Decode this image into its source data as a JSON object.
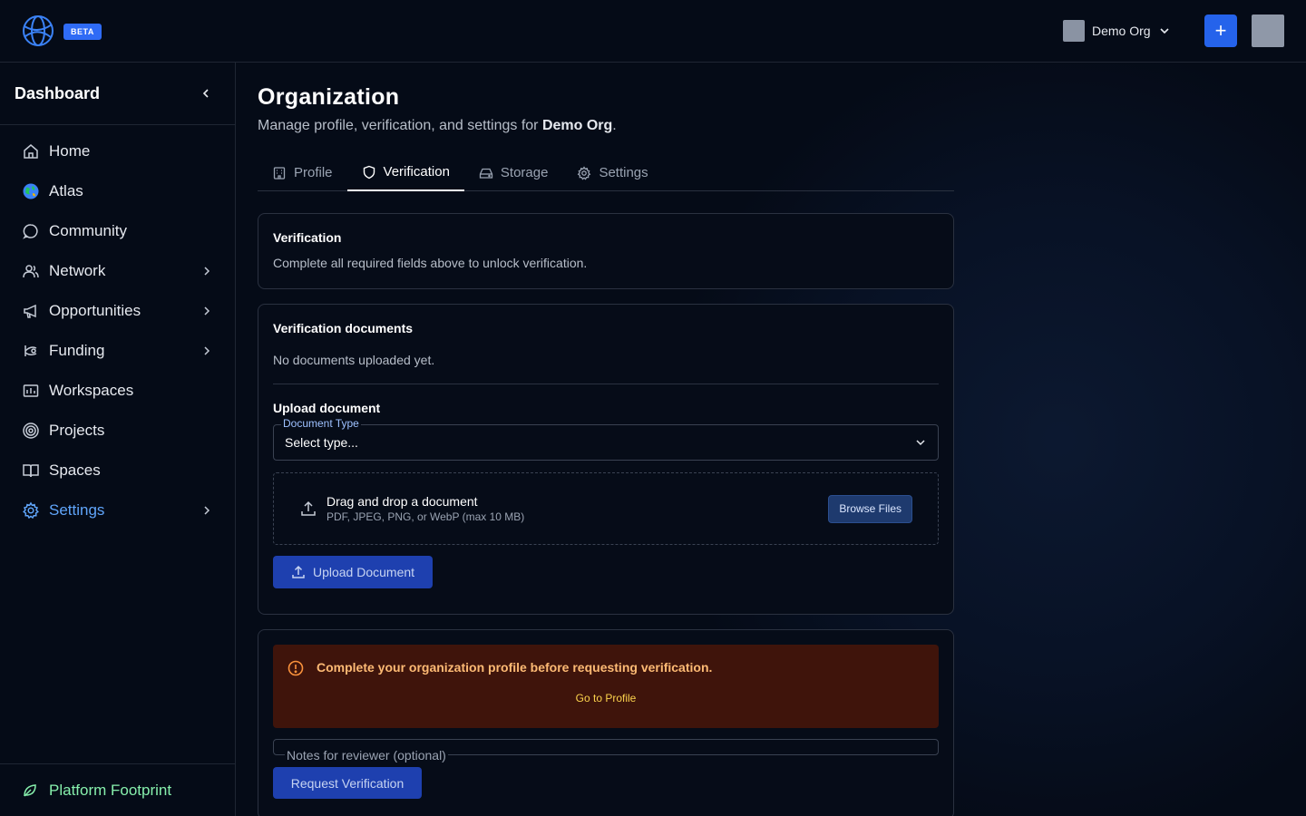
{
  "topbar": {
    "badge": "BETA",
    "org_name": "Demo Org",
    "plus_label": "+"
  },
  "sidebar": {
    "title": "Dashboard",
    "items": [
      {
        "label": "Home",
        "icon": "home-icon"
      },
      {
        "label": "Atlas",
        "icon": "globe-icon"
      },
      {
        "label": "Community",
        "icon": "chat-icon"
      },
      {
        "label": "Network",
        "icon": "users-icon"
      },
      {
        "label": "Opportunities",
        "icon": "megaphone-icon"
      },
      {
        "label": "Funding",
        "icon": "funding-icon"
      },
      {
        "label": "Workspaces",
        "icon": "workspace-icon"
      },
      {
        "label": "Projects",
        "icon": "target-icon"
      },
      {
        "label": "Spaces",
        "icon": "book-icon"
      },
      {
        "label": "Settings",
        "icon": "gear-icon"
      }
    ],
    "footer": "Platform Footprint"
  },
  "main": {
    "title": "Organization",
    "subtitle_prefix": "Manage profile, verification, and settings for ",
    "subtitle_org": "Demo Org",
    "subtitle_suffix": ".",
    "tabs": [
      "Profile",
      "Verification",
      "Storage",
      "Settings"
    ],
    "verification_card": {
      "title": "Verification",
      "text": "Complete all required fields above to unlock verification."
    },
    "documents_card": {
      "title": "Verification documents",
      "empty": "No documents uploaded yet.",
      "upload_heading": "Upload document",
      "doc_type_label": "Document Type",
      "doc_type_value": "Select type...",
      "drop_title": "Drag and drop a document",
      "drop_hint": "PDF, JPEG, PNG, or WebP (max 10 MB)",
      "browse_label": "Browse Files",
      "upload_label": "Upload Document"
    },
    "request_card": {
      "alert": "Complete your organization profile before requesting verification.",
      "alert_link": "Go to Profile",
      "notes_placeholder": "Notes for reviewer (optional)",
      "request_label": "Request Verification"
    }
  },
  "colors": {
    "accent": "#2563eb",
    "active_nav": "#60a5fa",
    "footer_green": "#86efac",
    "alert_bg": "#3f140b",
    "alert_text": "#fdba74"
  }
}
